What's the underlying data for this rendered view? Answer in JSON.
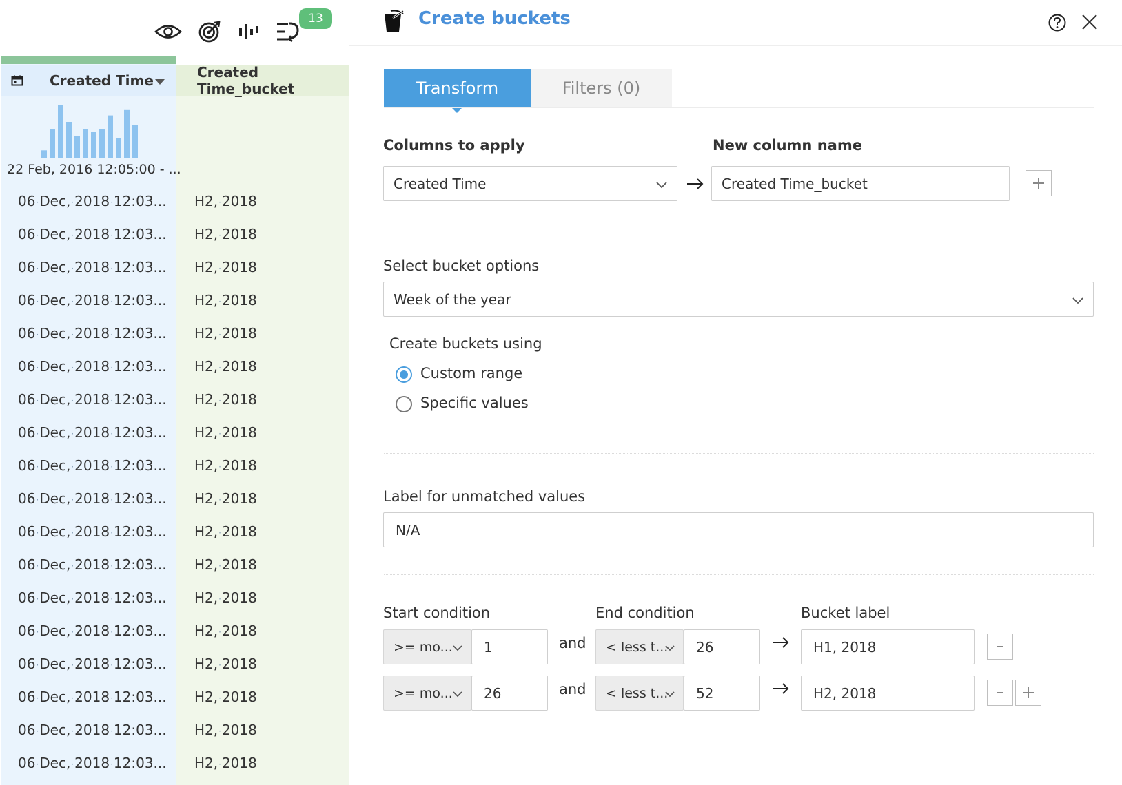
{
  "toolbar": {
    "icons": [
      "eye-icon",
      "target-icon",
      "bar-chart-icon",
      "undo-list-icon"
    ],
    "badge_count": "13"
  },
  "grid": {
    "columns": [
      {
        "name": "Created Time",
        "type_icon": "calendar-icon"
      },
      {
        "name": "Created Time_bucket"
      }
    ],
    "histogram": {
      "range_label": "22 Feb, 2016 12:05:00 - ...",
      "bars": [
        0.15,
        0.55,
        1.0,
        0.68,
        0.42,
        0.54,
        0.5,
        0.55,
        0.8,
        0.38,
        0.9,
        0.62
      ]
    },
    "rows": [
      {
        "created_time": [
          "06",
          "Dec,",
          "2018",
          "12:03..."
        ],
        "bucket": [
          "H2,",
          "2018"
        ]
      },
      {
        "created_time": [
          "06",
          "Dec,",
          "2018",
          "12:03..."
        ],
        "bucket": [
          "H2,",
          "2018"
        ]
      },
      {
        "created_time": [
          "06",
          "Dec,",
          "2018",
          "12:03..."
        ],
        "bucket": [
          "H2,",
          "2018"
        ]
      },
      {
        "created_time": [
          "06",
          "Dec,",
          "2018",
          "12:03..."
        ],
        "bucket": [
          "H2,",
          "2018"
        ]
      },
      {
        "created_time": [
          "06",
          "Dec,",
          "2018",
          "12:03..."
        ],
        "bucket": [
          "H2,",
          "2018"
        ]
      },
      {
        "created_time": [
          "06",
          "Dec,",
          "2018",
          "12:03..."
        ],
        "bucket": [
          "H2,",
          "2018"
        ]
      },
      {
        "created_time": [
          "06",
          "Dec,",
          "2018",
          "12:03..."
        ],
        "bucket": [
          "H2,",
          "2018"
        ]
      },
      {
        "created_time": [
          "06",
          "Dec,",
          "2018",
          "12:03..."
        ],
        "bucket": [
          "H2,",
          "2018"
        ]
      },
      {
        "created_time": [
          "06",
          "Dec,",
          "2018",
          "12:03..."
        ],
        "bucket": [
          "H2,",
          "2018"
        ]
      },
      {
        "created_time": [
          "06",
          "Dec,",
          "2018",
          "12:03..."
        ],
        "bucket": [
          "H2,",
          "2018"
        ]
      },
      {
        "created_time": [
          "06",
          "Dec,",
          "2018",
          "12:03..."
        ],
        "bucket": [
          "H2,",
          "2018"
        ]
      },
      {
        "created_time": [
          "06",
          "Dec,",
          "2018",
          "12:03..."
        ],
        "bucket": [
          "H2,",
          "2018"
        ]
      },
      {
        "created_time": [
          "06",
          "Dec,",
          "2018",
          "12:03..."
        ],
        "bucket": [
          "H2,",
          "2018"
        ]
      },
      {
        "created_time": [
          "06",
          "Dec,",
          "2018",
          "12:03..."
        ],
        "bucket": [
          "H2,",
          "2018"
        ]
      },
      {
        "created_time": [
          "06",
          "Dec,",
          "2018",
          "12:03..."
        ],
        "bucket": [
          "H2,",
          "2018"
        ]
      },
      {
        "created_time": [
          "06",
          "Dec,",
          "2018",
          "12:03..."
        ],
        "bucket": [
          "H2,",
          "2018"
        ]
      },
      {
        "created_time": [
          "06",
          "Dec,",
          "2018",
          "12:03..."
        ],
        "bucket": [
          "H2,",
          "2018"
        ]
      },
      {
        "created_time": [
          "06",
          "Dec,",
          "2018",
          "12:03..."
        ],
        "bucket": [
          "H2,",
          "2018"
        ]
      }
    ]
  },
  "panel": {
    "title": "Create buckets",
    "tabs": {
      "transform": "Transform",
      "filters": "Filters (0)"
    },
    "columns_to_apply_label": "Columns to apply",
    "columns_to_apply_value": "Created Time",
    "new_column_name_label": "New column name",
    "new_column_name_value": "Created Time_bucket",
    "bucket_options_label": "Select bucket options",
    "bucket_options_value": "Week of the year",
    "create_using_label": "Create buckets using",
    "radio_custom": "Custom range",
    "radio_specific": "Specific values",
    "unmatched_label": "Label for unmatched values",
    "unmatched_value": "N/A",
    "start_condition_label": "Start condition",
    "end_condition_label": "End condition",
    "bucket_label_label": "Bucket label",
    "and_word": "and",
    "conditions": [
      {
        "start_op": ">= mo...",
        "start_val": "1",
        "end_op": "< less t...",
        "end_val": "26",
        "label": "H1, 2018"
      },
      {
        "start_op": ">= mo...",
        "start_val": "26",
        "end_op": "< less t...",
        "end_val": "52",
        "label": "H2, 2018"
      }
    ],
    "colors": {
      "accent": "#4a9ede",
      "title": "#4a90d9",
      "badge": "#5fbf7a"
    }
  }
}
